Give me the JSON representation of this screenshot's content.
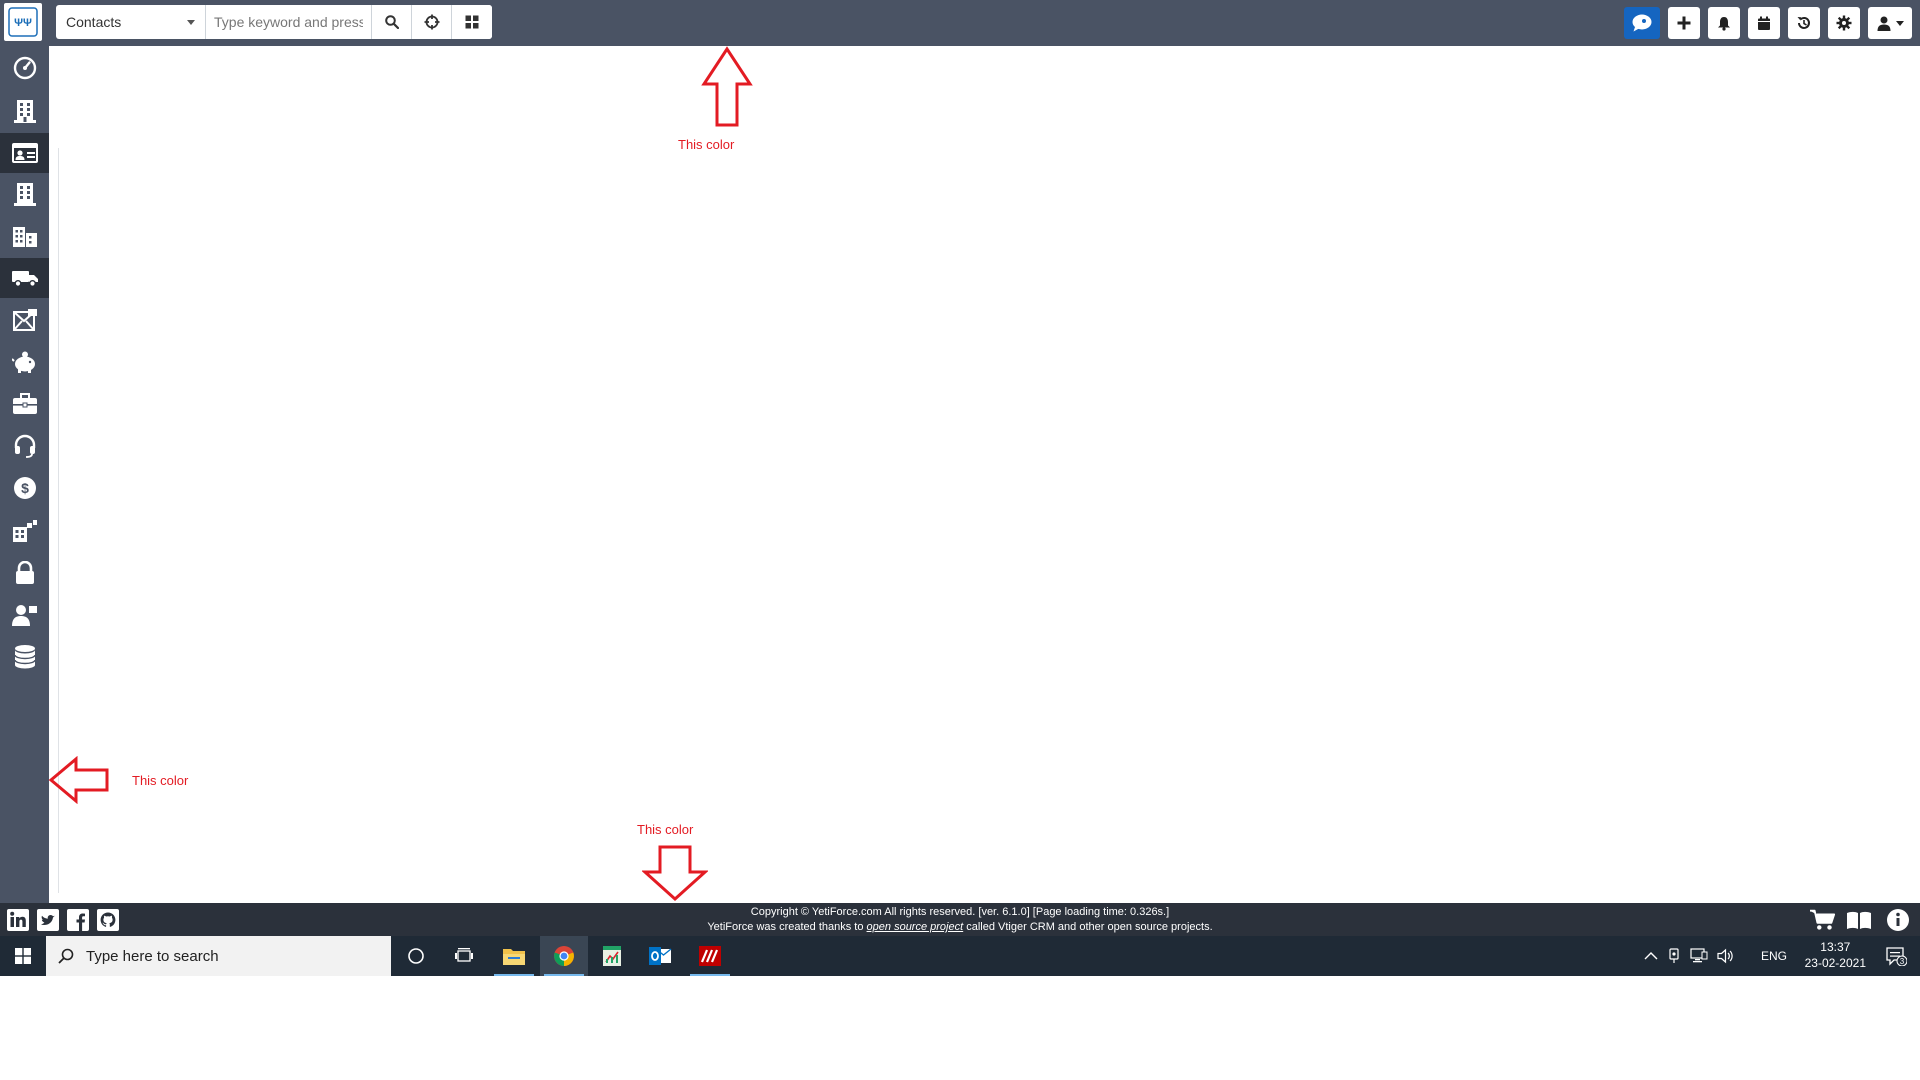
{
  "header": {
    "logo_alt": "YetiForce",
    "module_select": "Contacts",
    "search_placeholder": "Type keyword and press",
    "buttons": [
      "chat",
      "quick-create",
      "notifications",
      "calendar",
      "history",
      "settings",
      "user-menu"
    ]
  },
  "sidebar": {
    "items": [
      {
        "icon": "dashboard-icon"
      },
      {
        "icon": "building-icon"
      },
      {
        "icon": "id-card-icon"
      },
      {
        "icon": "company-icon"
      },
      {
        "icon": "buildings-icon"
      },
      {
        "icon": "truck-icon"
      },
      {
        "icon": "newsletter-icon"
      },
      {
        "icon": "piggy-bank-icon"
      },
      {
        "icon": "briefcase-icon"
      },
      {
        "icon": "headset-icon"
      },
      {
        "icon": "dollar-icon"
      },
      {
        "icon": "factory-icon"
      },
      {
        "icon": "lock-icon"
      },
      {
        "icon": "user-tag-icon"
      },
      {
        "icon": "database-icon"
      }
    ]
  },
  "annotations": {
    "top": "This color",
    "left": "This color",
    "bottom": "This color"
  },
  "footer": {
    "copyright": "Copyright © YetiForce.com All rights reserved. [ver. 6.1.0] [Page loading time: 0.326s.]",
    "credit_prefix": "YetiForce was created thanks to ",
    "credit_link": "open source project",
    "credit_suffix": " called Vtiger CRM and other open source projects."
  },
  "taskbar": {
    "search_placeholder": "Type here to search",
    "language": "ENG",
    "time": "13:37",
    "date": "23-02-2021",
    "notification_count": "3"
  },
  "colors": {
    "header_bg": "#4a5364",
    "footer_bg": "#2b313b",
    "taskbar_bg": "#1f2a36",
    "annotation_red": "#e31b23",
    "chat_blue": "#1565c0"
  }
}
